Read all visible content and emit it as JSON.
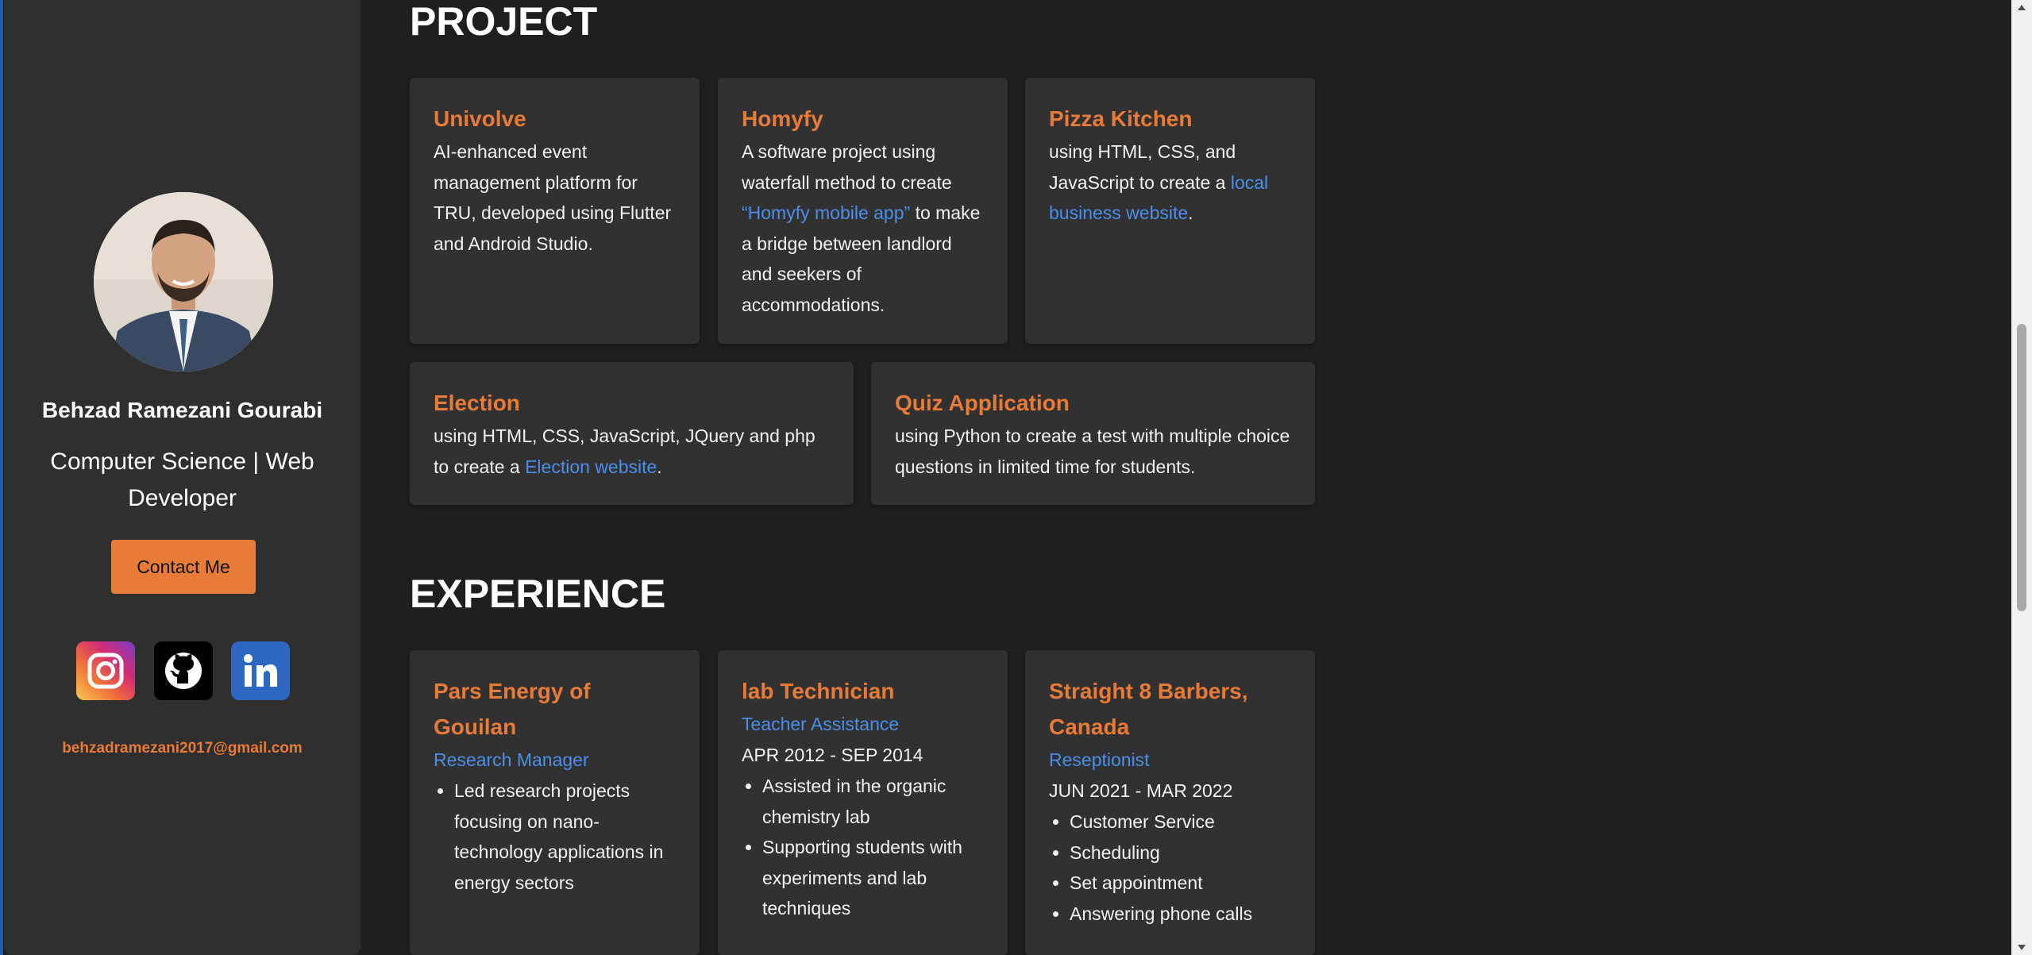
{
  "sidebar": {
    "name": "Behzad Ramezani Gourabi",
    "role": "Computer Science | Web Developer",
    "contact_label": "Contact Me",
    "email": "behzadramezani2017@gmail.com",
    "socials": [
      "instagram-icon",
      "github-icon",
      "linkedin-icon"
    ]
  },
  "projects": {
    "heading": "PROJECT",
    "univolve": {
      "title": "Univolve",
      "desc": "AI-enhanced event management platform for TRU, developed using Flutter and Android Studio."
    },
    "homyfy": {
      "title": "Homyfy",
      "desc_pre": "A software project using waterfall method to create ",
      "link": "“Homyfy mobile app”",
      "desc_post": " to make a bridge between landlord and seekers of accommodations."
    },
    "pizza": {
      "title": "Pizza Kitchen",
      "desc_pre": "using HTML, CSS, and JavaScript to create a ",
      "link": "local business website",
      "desc_post": "."
    },
    "election": {
      "title": "Election",
      "desc_pre": "using HTML, CSS, JavaScript, JQuery and php to create a ",
      "link": "Election website",
      "desc_post": "."
    },
    "quiz": {
      "title": "Quiz Application",
      "desc": "using Python to create a test with multiple choice questions in limited time for students."
    }
  },
  "experience": {
    "heading": "EXPERIENCE",
    "pars": {
      "title": "Pars Energy of Gouilan",
      "position": "Research Manager",
      "duties": [
        "Led research projects focusing on nano-technology applications in energy sectors"
      ]
    },
    "lab": {
      "title": "lab Technician",
      "position": "Teacher Assistance",
      "dates": "APR 2012 - SEP 2014",
      "duties": [
        "Assisted in the organic chemistry lab",
        "Supporting students with experiments and lab techniques"
      ]
    },
    "barbers": {
      "title": "Straight 8 Barbers, Canada",
      "position": "Reseptionist",
      "dates": "JUN 2021 - MAR 2022",
      "duties": [
        "Customer Service",
        "Scheduling",
        "Set appointment",
        "Answering phone calls"
      ]
    }
  },
  "colors": {
    "accent": "#e87b37",
    "link": "#4c8ee9",
    "background": "#1f1f1f",
    "card": "#313131"
  }
}
